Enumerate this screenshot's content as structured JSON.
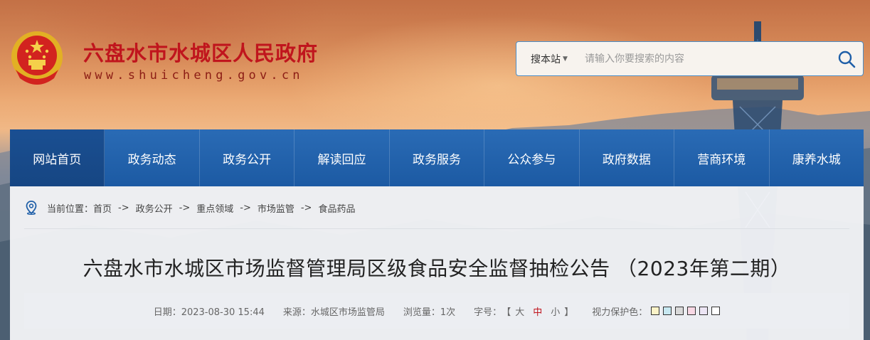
{
  "header": {
    "site_title": "六盘水市水城区人民政府",
    "site_url": "www.shuicheng.gov.cn",
    "emblem_icon": "national-emblem-icon"
  },
  "search": {
    "scope_label": "搜本站",
    "placeholder": "请输入你要搜索的内容",
    "button_icon": "search-icon"
  },
  "nav": {
    "items": [
      {
        "label": "网站首页"
      },
      {
        "label": "政务动态"
      },
      {
        "label": "政务公开"
      },
      {
        "label": "解读回应"
      },
      {
        "label": "政务服务"
      },
      {
        "label": "公众参与"
      },
      {
        "label": "政府数据"
      },
      {
        "label": "营商环境"
      },
      {
        "label": "康养水城"
      }
    ]
  },
  "breadcrumb": {
    "prefix": "当前位置：",
    "separator": "->",
    "items": [
      "首页",
      "政务公开",
      "重点领域",
      "市场监管",
      "食品药品"
    ]
  },
  "article": {
    "title": "六盘水市水城区市场监督管理局区级食品安全监督抽检公告 （2023年第二期）",
    "date": "日期：2023-08-30 15:44",
    "source": "来源：水城区市场监管局",
    "views": "浏览量：1次",
    "font_size_label": "字号：",
    "font_open": "【",
    "font_large": "大",
    "font_medium": "中",
    "font_small": "小",
    "font_close": "】",
    "eye_care_label": "视力保护色："
  },
  "colors": {
    "brand_red": "#c0151d",
    "nav_blue": "#1f5fa8",
    "swatches": [
      "#fbf3c8",
      "#c7e8f1",
      "#d9d9d9",
      "#f8d8e4",
      "#ece5f4",
      "#ffffff"
    ]
  }
}
